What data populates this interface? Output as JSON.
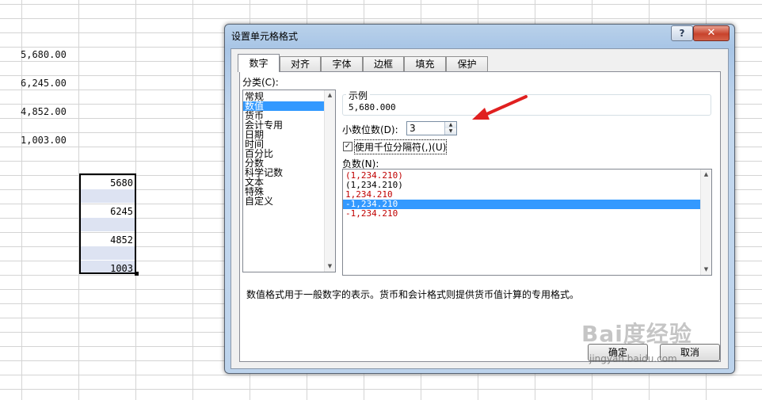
{
  "sheet": {
    "formatted_values": [
      "5,680.00",
      "6,245.00",
      "4,852.00",
      "1,003.00"
    ],
    "selected_values": [
      "5680",
      "6245",
      "4852",
      "1003"
    ]
  },
  "dialog": {
    "title": "设置单元格格式",
    "help_label": "?",
    "close_label": "✕",
    "tabs": [
      {
        "label": "数字",
        "active": true
      },
      {
        "label": "对齐",
        "active": false
      },
      {
        "label": "字体",
        "active": false
      },
      {
        "label": "边框",
        "active": false
      },
      {
        "label": "填充",
        "active": false
      },
      {
        "label": "保护",
        "active": false
      }
    ],
    "category_label": "分类(C):",
    "categories": [
      "常规",
      "数值",
      "货币",
      "会计专用",
      "日期",
      "时间",
      "百分比",
      "分数",
      "科学记数",
      "文本",
      "特殊",
      "自定义"
    ],
    "selected_category": "数值",
    "sample_label": "示例",
    "sample_value": "5,680.000",
    "decimal_label": "小数位数(D):",
    "decimal_value": "3",
    "thousands_label": "使用千位分隔符(,)(U)",
    "thousands_checked": true,
    "negative_label": "负数(N):",
    "negative_options": [
      {
        "text": "(1,234.210)",
        "color": "#c00000"
      },
      {
        "text": "(1,234.210)",
        "color": "#000000"
      },
      {
        "text": "1,234.210",
        "color": "#c00000"
      },
      {
        "text": "-1,234.210",
        "color": "#ffffff"
      },
      {
        "text": "-1,234.210",
        "color": "#c00000"
      }
    ],
    "description": "数值格式用于一般数字的表示。货币和会计格式则提供货币值计算的专用格式。",
    "ok_label": "确定",
    "cancel_label": "取消"
  },
  "watermark": {
    "logo": "Bai度经验",
    "url": "jingyan.baidu.com"
  },
  "colors": {
    "selection": "#3399ff",
    "negative_red": "#c00000",
    "arrow": "#e02020"
  }
}
